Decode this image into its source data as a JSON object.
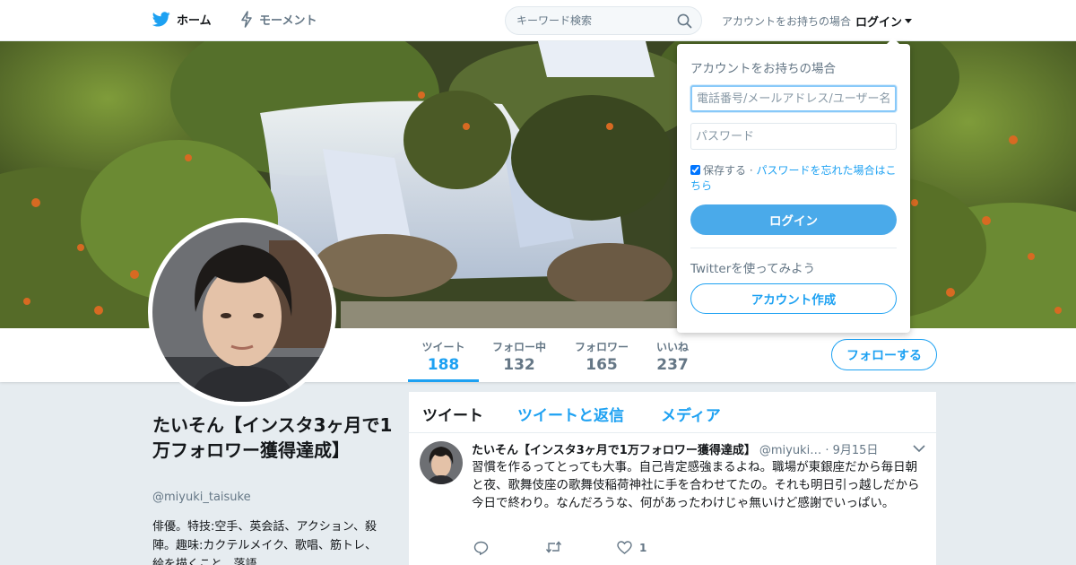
{
  "nav": {
    "home": "ホーム",
    "moments": "モーメント",
    "search_placeholder": "キーワード検索",
    "login_prompt": "アカウントをお持ちの場合",
    "login": "ログイン"
  },
  "login_dropdown": {
    "heading": "アカウントをお持ちの場合",
    "username_placeholder": "電話番号/メールアドレス/ユーザー名",
    "password_placeholder": "パスワード",
    "remember": "保存する",
    "separator": " · ",
    "forgot": "パスワードを忘れた場合はこちら",
    "login_button": "ログイン",
    "try_text": "Twitterを使ってみよう",
    "signup_button": "アカウント作成"
  },
  "stats": [
    {
      "label": "ツイート",
      "value": "188"
    },
    {
      "label": "フォロー中",
      "value": "132"
    },
    {
      "label": "フォロワー",
      "value": "165"
    },
    {
      "label": "いいね",
      "value": "237"
    }
  ],
  "follow_button": "フォローする",
  "profile": {
    "name": "たいそん【インスタ3ヶ月で1万フォロワー獲得達成】",
    "handle": "@miyuki_taisuke",
    "bio": "俳優。特技:空手、英会話、アクション、殺陣。趣味:カクテルメイク、歌唱、筋トレ、絵を描くこと、落語"
  },
  "timeline_tabs": [
    "ツイート",
    "ツイートと返信",
    "メディア"
  ],
  "tweet": {
    "name": "たいそん【インスタ3ヶ月で1万フォロワー獲得達成】",
    "handle": "@miyuki…",
    "date": " · 9月15日",
    "text": "習慣を作るってとっても大事。自己肯定感強まるよね。職場が東銀座だから毎日朝と夜、歌舞伎座の歌舞伎稲荷神社に手を合わせてたの。それも明日引っ越しだから今日で終わり。なんだろうな、何があったわけじゃ無いけど感謝でいっぱい。",
    "like_count": "1"
  },
  "colors": {
    "accent": "#1da1f2",
    "background": "#e6ecf0",
    "button_fill": "#4aaaea"
  },
  "icons": [
    "twitter-bird-icon",
    "lightning-icon",
    "search-icon",
    "caret-down-icon",
    "reply-icon",
    "retweet-icon",
    "heart-icon",
    "chevron-down-icon"
  ]
}
